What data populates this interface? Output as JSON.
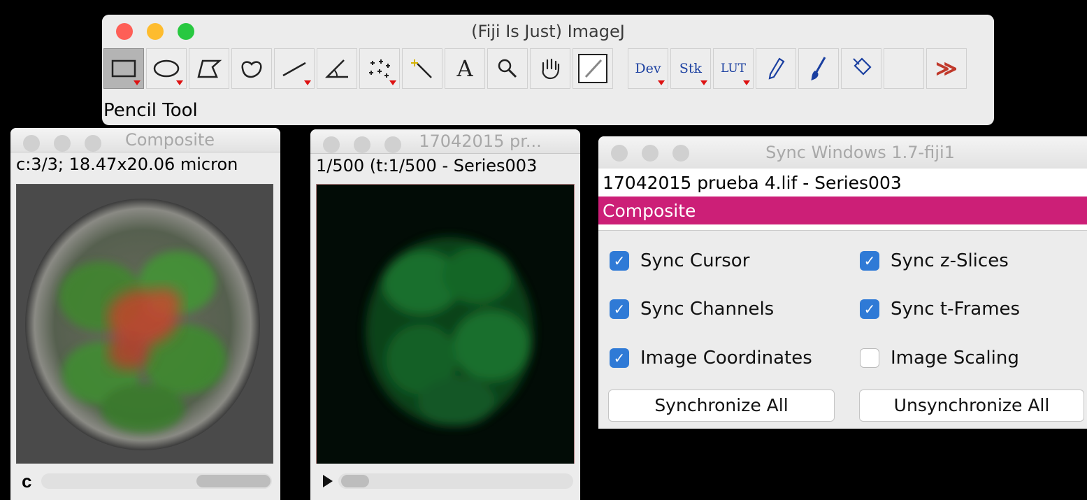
{
  "imagej": {
    "title": "(Fiji Is Just) ImageJ",
    "status": "Pencil Tool",
    "tools": {
      "text_tool_glyph": "A",
      "dev_label": "Dev",
      "stk_label": "Stk",
      "lut_label": "LUT",
      "more_glyph": "≫"
    }
  },
  "composite_window": {
    "title": "Composite",
    "info": "c:3/3; 18.47x20.06 micron",
    "channel_label": "c"
  },
  "series_window": {
    "title": "17042015 pr...",
    "info": "1/500 (t:1/500 - Series003"
  },
  "sync_window": {
    "title": "Sync Windows 1.7-fiji1",
    "list": [
      "17042015 prueba 4.lif - Series003",
      "Composite"
    ],
    "selected_index": 1,
    "options": {
      "sync_cursor": {
        "label": "Sync Cursor",
        "checked": true
      },
      "sync_z_slices": {
        "label": "Sync z-Slices",
        "checked": true
      },
      "sync_channels": {
        "label": "Sync Channels",
        "checked": true
      },
      "sync_t_frames": {
        "label": "Sync t-Frames",
        "checked": true
      },
      "image_coordinates": {
        "label": "Image Coordinates",
        "checked": true
      },
      "image_scaling": {
        "label": "Image Scaling",
        "checked": false
      }
    },
    "buttons": {
      "synchronize_all": "Synchronize All",
      "unsynchronize_all": "Unsynchronize All"
    }
  },
  "colors": {
    "selection": "#cc1f77",
    "checkbox": "#2f7ad6",
    "close": "#fe5f57",
    "minimize": "#febc2e",
    "zoom": "#28c840"
  }
}
